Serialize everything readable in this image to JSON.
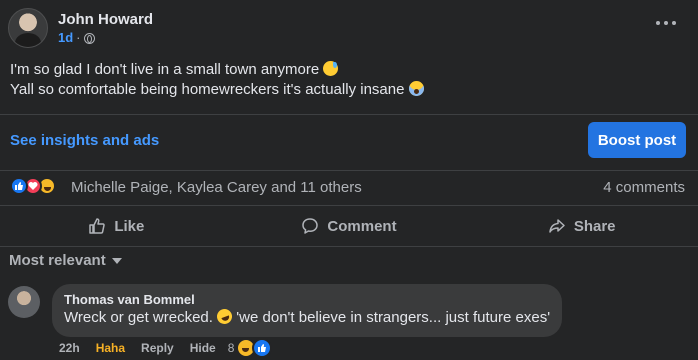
{
  "post": {
    "author": "John Howard",
    "time": "1d",
    "separator": "·",
    "lines": [
      "I'm so glad I don't live in a small town anymore",
      "Yall so comfortable being homewreckers it's actually insane"
    ]
  },
  "insights": {
    "link_label": "See insights and ads",
    "boost_label": "Boost post"
  },
  "reactions": {
    "names": "Michelle Paige, Kaylea Carey and 11 others",
    "comments_count": "4 comments"
  },
  "actions": {
    "like": "Like",
    "comment": "Comment",
    "share": "Share"
  },
  "sort_label": "Most relevant",
  "comment": {
    "author": "Thomas van Bommel",
    "text_before": "Wreck or get wrecked.",
    "text_after": "'we don't believe in strangers... just future exes'",
    "time": "22h",
    "reaction_label": "Haha",
    "reply_label": "Reply",
    "hide_label": "Hide",
    "reaction_count": "8"
  },
  "colors": {
    "background": "#242526",
    "accent": "#4599ff",
    "button": "#2374e1",
    "haha": "#f7b125"
  }
}
